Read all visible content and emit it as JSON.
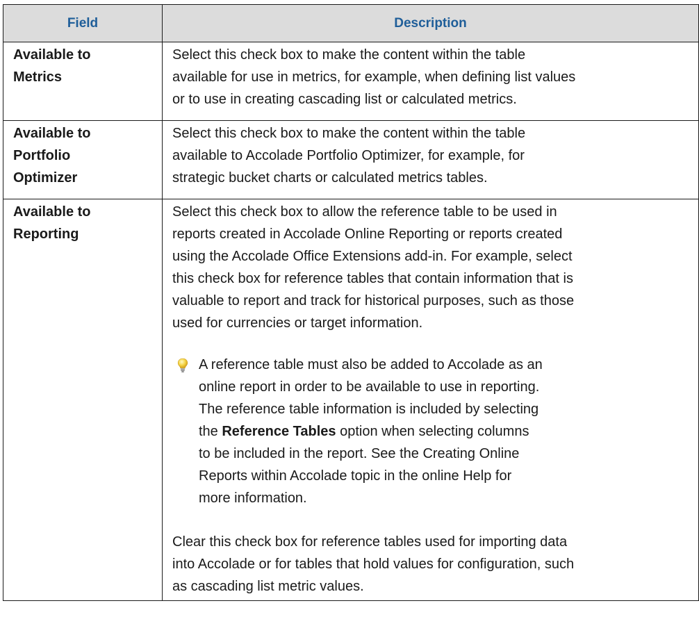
{
  "table": {
    "headers": {
      "field": "Field",
      "description": "Description"
    },
    "rows": [
      {
        "field_lines": [
          "Available to",
          "Metrics"
        ],
        "description_lines": [
          "Select this check box to make the content within the table",
          "available for use in metrics, for example, when defining list values",
          "or to use in creating cascading list or calculated metrics."
        ]
      },
      {
        "field_lines": [
          "Available to",
          "Portfolio",
          "Optimizer"
        ],
        "description_lines": [
          "Select this check box to make the content within the table",
          "available to Accolade Portfolio Optimizer, for example, for",
          "strategic bucket charts or calculated metrics tables."
        ]
      },
      {
        "field_lines": [
          "Available to",
          "Reporting"
        ],
        "description_lines": [
          "Select this check box to allow the reference table to be used in",
          "reports created in Accolade Online Reporting or reports created",
          "using the Accolade Office Extensions add-in. For example, select",
          "this check box for reference tables that contain information that is",
          "valuable to report and track for historical purposes, such as those",
          "used for currencies or target information."
        ],
        "tip": {
          "icon": "lightbulb-icon",
          "icon_color": "#f5d547",
          "line_1": "A reference table must also be added to Accolade as an",
          "line_2": "online report in order to be available to use in reporting.",
          "line_3": "The reference table information is included by selecting",
          "line_4_prefix": "the ",
          "line_4_bold": "Reference Tables",
          "line_4_suffix": " option when selecting columns",
          "line_5": "to be included in the report. See the Creating Online",
          "line_6": "Reports within Accolade topic in the online Help for",
          "line_7": "more information."
        },
        "after_tip_lines": [
          "Clear this check box for reference tables used for importing data",
          "into Accolade or for tables that hold values for configuration, such",
          "as cascading list metric values."
        ]
      }
    ]
  },
  "colors": {
    "header_background": "#dcdcdc",
    "header_text": "#1f5e99",
    "border": "#1a1a1a"
  }
}
